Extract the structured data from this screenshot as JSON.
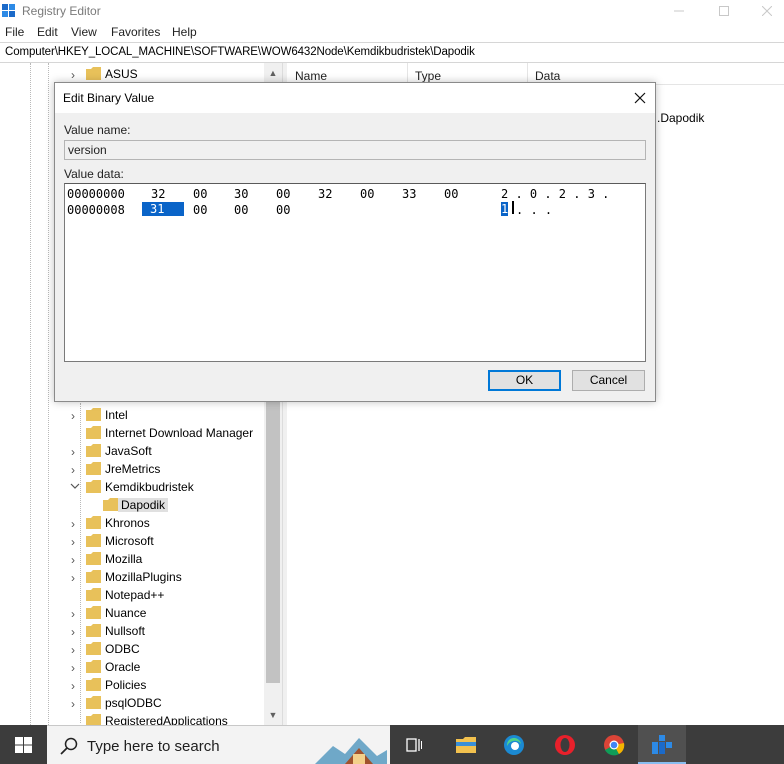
{
  "window": {
    "title": "Registry Editor",
    "menu": [
      "File",
      "Edit",
      "View",
      "Favorites",
      "Help"
    ],
    "address": "Computer\\HKEY_LOCAL_MACHINE\\SOFTWARE\\WOW6432Node\\Kemdikbudristek\\Dapodik"
  },
  "tree": {
    "top_item": "ASUS",
    "items": [
      {
        "label": "Intel",
        "expanded": false
      },
      {
        "label": "Internet Download Manager",
        "expanded": null
      },
      {
        "label": "JavaSoft",
        "expanded": false
      },
      {
        "label": "JreMetrics",
        "expanded": false
      },
      {
        "label": "Kemdikbudristek",
        "expanded": true
      },
      {
        "label": "Dapodik",
        "selected": true
      },
      {
        "label": "Khronos",
        "expanded": false
      },
      {
        "label": "Microsoft",
        "expanded": false
      },
      {
        "label": "Mozilla",
        "expanded": false
      },
      {
        "label": "MozillaPlugins",
        "expanded": false
      },
      {
        "label": "Notepad++",
        "expanded": null
      },
      {
        "label": "Nuance",
        "expanded": false
      },
      {
        "label": "Nullsoft",
        "expanded": false
      },
      {
        "label": "ODBC",
        "expanded": false
      },
      {
        "label": "Oracle",
        "expanded": false
      },
      {
        "label": "Policies",
        "expanded": false
      },
      {
        "label": "psqlODBC",
        "expanded": false
      },
      {
        "label": "RegisteredApplications",
        "expanded": null
      }
    ]
  },
  "list": {
    "columns": [
      "Name",
      "Type",
      "Data"
    ],
    "visible_data": ".Dapodik"
  },
  "dialog": {
    "title": "Edit Binary Value",
    "value_name_label": "Value name:",
    "value_name": "version",
    "value_data_label": "Value data:",
    "rows": [
      {
        "offset": "00000000",
        "bytes": [
          "32",
          "00",
          "30",
          "00",
          "32",
          "00",
          "33",
          "00"
        ],
        "ascii": "2 . 0 . 2 . 3 ."
      },
      {
        "offset": "00000008",
        "bytes": [
          "31",
          "00",
          "00",
          "00"
        ],
        "ascii_selected": "1",
        "ascii_rest": ". . ."
      }
    ],
    "ok_label": "OK",
    "cancel_label": "Cancel"
  },
  "taskbar": {
    "search_placeholder": "Type here to search",
    "apps": [
      "task-view-icon",
      "file-explorer-icon",
      "edge-icon",
      "opera-icon",
      "chrome-icon",
      "regedit-icon"
    ]
  },
  "colors": {
    "selection": "#0a64c8",
    "ok_border": "#0078d7",
    "folder": "#e8c15a",
    "taskbar": "#3c3c3c"
  }
}
